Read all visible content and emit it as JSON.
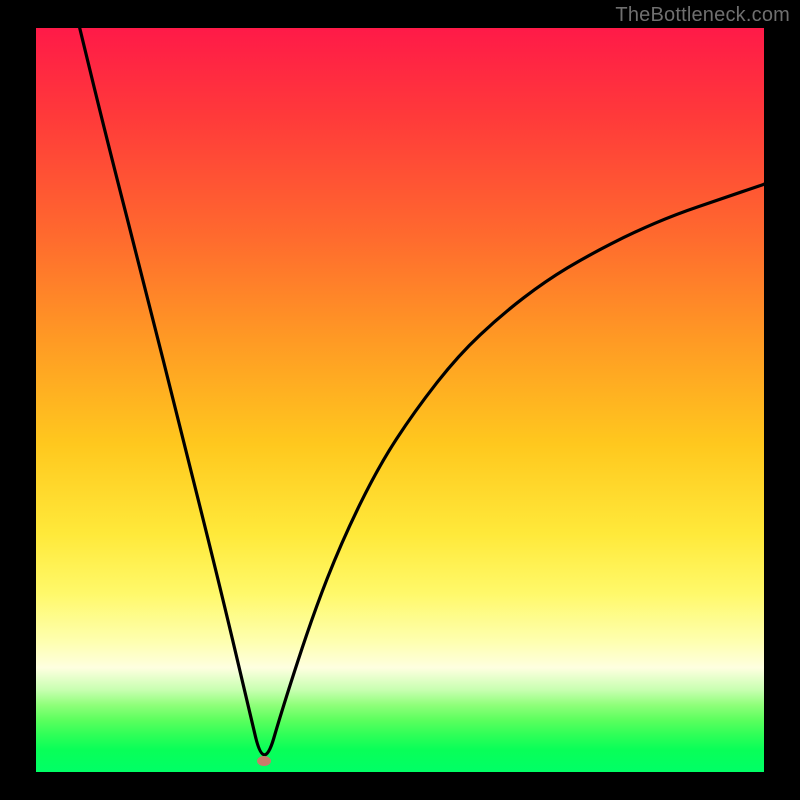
{
  "watermark": "TheBottleneck.com",
  "colors": {
    "page_bg": "#000000",
    "watermark_text": "#6f6f6f",
    "curve_stroke": "#000000",
    "marker_fill": "#c97a6a",
    "gradient_top": "#ff1a48",
    "gradient_mid": "#ffe93a",
    "gradient_bottom": "#00ff66"
  },
  "marker": {
    "x_frac": 0.313,
    "y_frac": 0.985
  },
  "chart_data": {
    "type": "line",
    "title": "",
    "xlabel": "",
    "ylabel": "",
    "xlim": [
      0,
      1
    ],
    "ylim": [
      0,
      1
    ],
    "grid": false,
    "legend": false,
    "annotations": [
      "TheBottleneck.com"
    ],
    "series": [
      {
        "name": "bottleneck-curve",
        "note": "V-shaped curve. x and y are normalized fractions of the plot area (0 = left/top edge in screen coords; y is given as (1 - fraction_from_top) so 0 = bottom, 1 = top). Minimum (optimum) at x≈0.313 where y≈0. Left branch is near-linear and steep; right branch is concave, asymptoting below y≈0.8 at x=1.",
        "x": [
          0.06,
          0.1,
          0.15,
          0.2,
          0.25,
          0.29,
          0.313,
          0.34,
          0.38,
          0.42,
          0.47,
          0.52,
          0.58,
          0.64,
          0.7,
          0.76,
          0.82,
          0.88,
          0.94,
          1.0
        ],
        "y": [
          1.0,
          0.84,
          0.65,
          0.455,
          0.26,
          0.095,
          0.0,
          0.09,
          0.21,
          0.31,
          0.41,
          0.485,
          0.56,
          0.615,
          0.66,
          0.695,
          0.725,
          0.75,
          0.77,
          0.79
        ]
      }
    ],
    "optimum_marker": {
      "x": 0.313,
      "y": 0.015
    }
  }
}
